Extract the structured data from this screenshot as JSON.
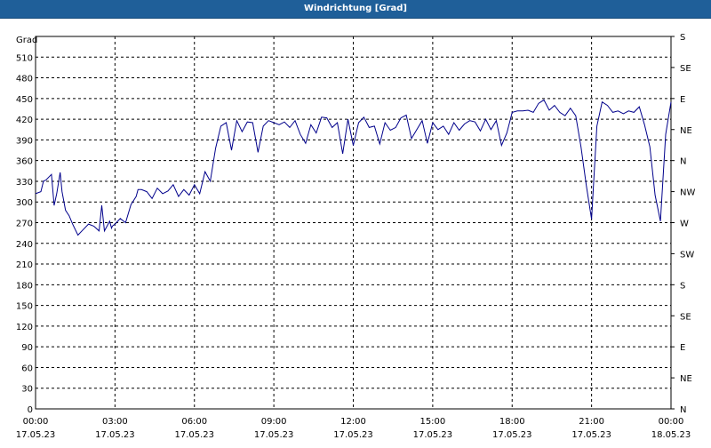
{
  "window": {
    "title": "Windrichtung [Grad]"
  },
  "colors": {
    "titlebar": "#1f5f99",
    "series": "#00008b",
    "grid": "#000000"
  },
  "chart_data": {
    "type": "line",
    "title": "Windrichtung [Grad]",
    "ylabel": "Grad",
    "ylim": [
      0,
      540
    ],
    "xlim": [
      "2023-05-17 00:00",
      "2023-05-18 00:00"
    ],
    "grid": true,
    "y_ticks": [
      0,
      30,
      60,
      90,
      120,
      150,
      180,
      210,
      240,
      270,
      300,
      330,
      360,
      390,
      420,
      450,
      480,
      510
    ],
    "y_tick_labels": [
      "0",
      "30",
      "60",
      "90",
      "120",
      "150",
      "180",
      "210",
      "240",
      "270",
      "300",
      "330",
      "360",
      "390",
      "420",
      "450",
      "480",
      "510"
    ],
    "x_ticks": [
      {
        "time": "00:00",
        "date": "17.05.23",
        "hour": 0
      },
      {
        "time": "03:00",
        "date": "17.05.23",
        "hour": 3
      },
      {
        "time": "06:00",
        "date": "17.05.23",
        "hour": 6
      },
      {
        "time": "09:00",
        "date": "17.05.23",
        "hour": 9
      },
      {
        "time": "12:00",
        "date": "17.05.23",
        "hour": 12
      },
      {
        "time": "15:00",
        "date": "17.05.23",
        "hour": 15
      },
      {
        "time": "18:00",
        "date": "17.05.23",
        "hour": 18
      },
      {
        "time": "21:00",
        "date": "17.05.23",
        "hour": 21
      },
      {
        "time": "00:00",
        "date": "18.05.23",
        "hour": 24
      }
    ],
    "right_axis": [
      {
        "value": 0,
        "label": "N"
      },
      {
        "value": 45,
        "label": "NE"
      },
      {
        "value": 90,
        "label": "E"
      },
      {
        "value": 135,
        "label": "SE"
      },
      {
        "value": 180,
        "label": "S"
      },
      {
        "value": 225,
        "label": "SW"
      },
      {
        "value": 270,
        "label": "W"
      },
      {
        "value": 315,
        "label": "NW"
      },
      {
        "value": 360,
        "label": "N"
      },
      {
        "value": 405,
        "label": "NE"
      },
      {
        "value": 450,
        "label": "E"
      },
      {
        "value": 495,
        "label": "SE"
      },
      {
        "value": 540,
        "label": "S"
      }
    ],
    "series": [
      {
        "x": [
          0,
          0.2,
          0.3,
          0.4,
          0.6,
          0.7,
          0.8,
          0.93,
          1.0,
          1.13,
          1.27,
          1.4,
          1.6,
          1.8,
          2.0,
          2.2,
          2.4,
          2.5,
          2.6,
          2.8,
          2.87,
          2.9,
          3.0,
          3.1,
          3.2,
          3.4,
          3.6,
          3.8,
          3.87,
          4.0,
          4.2,
          4.4,
          4.6,
          4.8,
          5.0,
          5.2,
          5.4,
          5.6,
          5.8,
          6.0,
          6.2,
          6.4,
          6.6,
          6.8,
          7.0,
          7.2,
          7.4,
          7.6,
          7.8,
          8.0,
          8.2,
          8.4,
          8.6,
          8.8,
          9.0,
          9.2,
          9.4,
          9.6,
          9.8,
          10.0,
          10.2,
          10.4,
          10.6,
          10.8,
          11.0,
          11.2,
          11.4,
          11.6,
          11.8,
          12.0,
          12.2,
          12.4,
          12.6,
          12.8,
          13.0,
          13.2,
          13.4,
          13.6,
          13.8,
          14.0,
          14.2,
          14.4,
          14.6,
          14.8,
          15.0,
          15.2,
          15.4,
          15.6,
          15.8,
          16.0,
          16.2,
          16.4,
          16.6,
          16.8,
          17.0,
          17.2,
          17.4,
          17.6,
          17.8,
          18.0,
          18.2,
          18.4,
          18.6,
          18.8,
          19.0,
          19.2,
          19.4,
          19.6,
          19.8,
          20.0,
          20.2,
          20.4,
          20.6,
          20.8,
          21.0,
          21.2,
          21.4,
          21.6,
          21.8,
          22.0,
          22.2,
          22.4,
          22.6,
          22.8,
          23.0,
          23.2,
          23.4,
          23.6,
          23.8,
          24.0
        ],
        "y": [
          312,
          315,
          330,
          332,
          340,
          295,
          312,
          343,
          315,
          288,
          280,
          268,
          252,
          260,
          268,
          265,
          258,
          295,
          258,
          272,
          262,
          265,
          268,
          272,
          276,
          270,
          296,
          308,
          318,
          318,
          315,
          305,
          320,
          312,
          316,
          325,
          308,
          318,
          310,
          325,
          312,
          344,
          330,
          378,
          410,
          415,
          375,
          418,
          402,
          416,
          415,
          372,
          410,
          418,
          415,
          412,
          416,
          408,
          418,
          398,
          385,
          412,
          400,
          423,
          422,
          408,
          415,
          370,
          420,
          382,
          415,
          423,
          408,
          410,
          384,
          415,
          404,
          408,
          422,
          426,
          392,
          405,
          418,
          385,
          415,
          405,
          410,
          398,
          415,
          404,
          413,
          418,
          416,
          403,
          420,
          405,
          418,
          382,
          400,
          430,
          432,
          432,
          433,
          430,
          443,
          448,
          433,
          440,
          430,
          425,
          436,
          425,
          380,
          324,
          275,
          410,
          445,
          440,
          430,
          432,
          428,
          432,
          430,
          438,
          412,
          380,
          310,
          272,
          398,
          445
        ]
      }
    ]
  }
}
